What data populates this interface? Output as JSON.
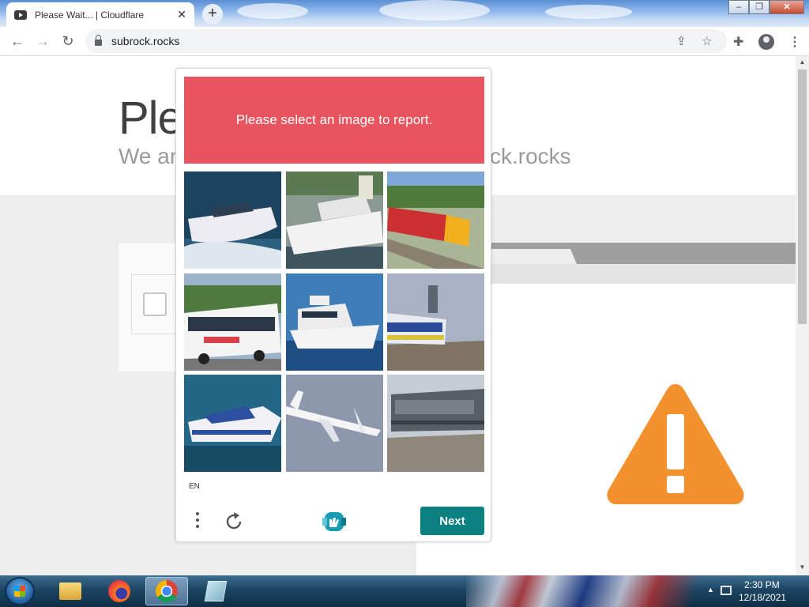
{
  "browser": {
    "tab_title": "Please Wait... | Cloudflare",
    "tab_close": "✕",
    "new_tab": "+",
    "url": "subrock.rocks",
    "window_buttons": {
      "minimize": "–",
      "restore": "❐",
      "close": "✕"
    }
  },
  "page": {
    "heading": "Ple",
    "subheading_left": "We ar",
    "subheading_right": "ck.rocks"
  },
  "captcha": {
    "prompt": "Please select an image to report.",
    "language": "EN",
    "next_label": "Next",
    "tiles": [
      {
        "subject": "speedboat",
        "colors": {
          "bg": "#1c4360",
          "fg": "#ececf2"
        }
      },
      {
        "subject": "yacht in harbor",
        "colors": {
          "bg": "#6a7f7a",
          "fg": "#f2f2f2"
        }
      },
      {
        "subject": "red locomotive",
        "colors": {
          "bg": "#9ea78a",
          "fg": "#cc3030"
        }
      },
      {
        "subject": "white bus",
        "colors": {
          "bg": "#6f8a63",
          "fg": "#f4f4f4"
        }
      },
      {
        "subject": "yacht at sea",
        "colors": {
          "bg": "#1e4f82",
          "fg": "#f4f4f4"
        }
      },
      {
        "subject": "blue white train",
        "colors": {
          "bg": "#7a8492",
          "fg": "#2a4a9a"
        }
      },
      {
        "subject": "motorboat",
        "colors": {
          "bg": "#246685",
          "fg": "#f0f0f6"
        }
      },
      {
        "subject": "airplane",
        "colors": {
          "bg": "#8d98ad",
          "fg": "#f4f4f4"
        }
      },
      {
        "subject": "gray locomotive",
        "colors": {
          "bg": "#b9bfc8",
          "fg": "#585e66"
        }
      }
    ]
  },
  "taskbar": {
    "time": "2:30 PM",
    "date": "12/18/2021",
    "items": [
      "file-explorer",
      "firefox",
      "chrome",
      "app"
    ]
  },
  "colors": {
    "captcha_header": "#e8555e",
    "next_button": "#0a8080",
    "warning": "#f4912f"
  }
}
